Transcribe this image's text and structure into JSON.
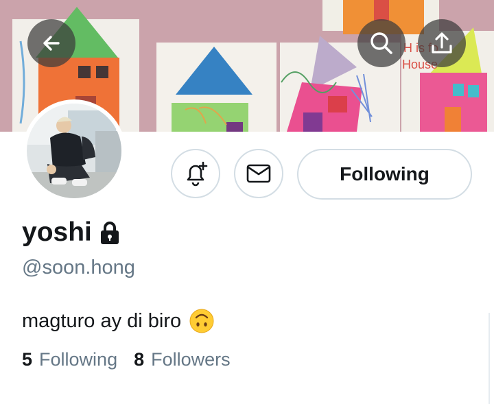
{
  "banner": {
    "description_icons": [
      "back-arrow-icon",
      "search-icon",
      "share-icon"
    ],
    "painted_text": [
      "H is fo",
      "House"
    ]
  },
  "actions": {
    "bell_icon": "bell-plus-icon",
    "mail_icon": "envelope-icon",
    "following_label": "Following"
  },
  "profile": {
    "display_name": "yoshi",
    "lock_icon": "lock-icon",
    "handle": "@soon.hong",
    "bio": "magturo ay di biro",
    "bio_emoji": "upside-down-face-emoji"
  },
  "stats": {
    "following_count": "5",
    "following_label": "Following",
    "followers_count": "8",
    "followers_label": "Followers"
  },
  "colors": {
    "muted_text": "#657786",
    "border": "#d3dde4",
    "primary_text": "#14171a"
  }
}
